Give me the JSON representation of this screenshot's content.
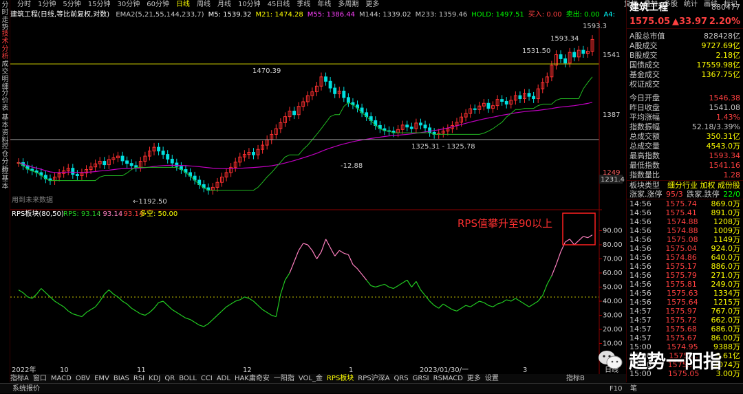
{
  "left_tabs": [
    {
      "label": "分时走势",
      "active": false
    },
    {
      "label": "技术分析",
      "active": true
    },
    {
      "label": "成交明细",
      "active": false
    },
    {
      "label": "分价表",
      "active": false
    },
    {
      "label": "基本资料",
      "active": false
    },
    {
      "label": "控仓分析",
      "active": false
    },
    {
      "label": "控基本",
      "active": false
    }
  ],
  "periods": [
    "分时",
    "1分钟",
    "5分钟",
    "15分钟",
    "30分钟",
    "60分钟",
    "日线",
    "周线",
    "月线",
    "10分钟",
    "45日线",
    "季线",
    "年线",
    "多周期",
    "更多"
  ],
  "selected_period": "日线",
  "tools": [
    "复权",
    "叠加",
    "多股",
    "统计",
    "画线",
    "标记"
  ],
  "main_title": "建筑工程(日线,等比前复权,对数)",
  "indicators": [
    {
      "t": "EMA2(5,21,55,144,233,7)",
      "c": "#c8c8c8"
    },
    {
      "t": "M5: 1539.32",
      "c": "#ffffff"
    },
    {
      "t": "M21: 1474.28",
      "c": "#ffff00"
    },
    {
      "t": "M55: 1386.44",
      "c": "#ff40ff"
    },
    {
      "t": "M144: 1339.02",
      "c": "#c8c8c8"
    },
    {
      "t": "M233: 1359.46",
      "c": "#c8c8c8"
    },
    {
      "t": "HOLD: 1497.51",
      "c": "#00ff00"
    },
    {
      "t": "买入: 0.00",
      "c": "#ff4040"
    },
    {
      "t": "卖出: 0.00",
      "c": "#00ff00"
    },
    {
      "t": "A4: 1593.34",
      "c": "#00ffff"
    },
    {
      "t": "BB: 1541.16",
      "c": "#c8c8c8"
    },
    {
      "t": "高价: 15",
      "c": "#c8c8c8"
    }
  ],
  "price_labels": {
    "p1593": "1593.34",
    "p1531": "1531.50",
    "p1470": "1470.39",
    "p1325": "1325.31 - 1325.78",
    "p1288": "-12.88",
    "p1192": "←1192.50",
    "p15933top": "1593.3"
  },
  "axis_main": {
    "a1541": "1541",
    "a1387": "1387",
    "a1231": "1231.4",
    "a1249": "1249"
  },
  "future_data_note": "用到未来数据",
  "rps": {
    "title": "RPS板块(80,50)",
    "v1": "RPS: 93.14",
    "v2": "93.14",
    "v3": "93.14",
    "v4": "多空: 50.00",
    "annot": "RPS值攀升至90以上",
    "axis": [
      "90.00",
      "80.00",
      "70.00",
      "60.00",
      "50.00",
      "40.00",
      "30.00",
      "20.00",
      "10.00"
    ]
  },
  "x_axis": [
    "2022年",
    "10",
    "11",
    "12",
    "1",
    "2023/01/30/一",
    "3",
    "日线"
  ],
  "bottom_tabs": [
    "指标A",
    "窗口",
    "MACD",
    "OBV",
    "EMV",
    "BIAS",
    "RSI",
    "KDJ",
    "QR",
    "BOLL",
    "CCI",
    "ADL",
    "HAK庸奇安",
    "一阳指",
    "VOL_金",
    "RPS板块",
    "RPS沪深A",
    "QRS",
    "GRSI",
    "RSMACD",
    "更多",
    "设置",
    "指标B"
  ],
  "selected_bottom_tab": "RPS板块",
  "status": {
    "label": "系统报价",
    "f10": "F10",
    "pen": "笔"
  },
  "watermark": "趋势一阳指",
  "panel": {
    "name": "建筑工程",
    "code": "880477",
    "price": "1575.05",
    "change": "▲33.97",
    "pct": "2.20%",
    "stats": [
      {
        "k": "A股总市值",
        "v": "828428亿",
        "c": "#c8c8c8"
      },
      {
        "k": "A股成交",
        "v": "9727.69亿",
        "c": "#ffff00"
      },
      {
        "k": "B股成交",
        "v": "2.18亿",
        "c": "#ffff00"
      },
      {
        "k": "国债成交",
        "v": "17559.98亿",
        "c": "#ffff00"
      },
      {
        "k": "基金成交",
        "v": "1367.75亿",
        "c": "#ffff00"
      },
      {
        "k": "权证成交",
        "v": "",
        "c": "#ffff00"
      },
      {
        "k": "今日开盘",
        "v": "1546.38",
        "c": "#ff4040"
      },
      {
        "k": "昨日收盘",
        "v": "1541.08",
        "c": "#c8c8c8"
      },
      {
        "k": "平均涨幅",
        "v": "1.43%",
        "c": "#ff4040"
      },
      {
        "k": "指数振幅",
        "v": "52.18/3.39%",
        "c": "#c8c8c8"
      },
      {
        "k": "总成交额",
        "v": "350.31亿",
        "c": "#ffff00"
      },
      {
        "k": "总成交量",
        "v": "4543.0万",
        "c": "#ffff00"
      },
      {
        "k": "最高指数",
        "v": "1593.34",
        "c": "#ff4040"
      },
      {
        "k": "最低指数",
        "v": "1541.16",
        "c": "#ff4040"
      },
      {
        "k": "指数量比",
        "v": "1.28",
        "c": "#ff4040"
      }
    ],
    "board_type_label": "板块类型",
    "board_type_val": "细分行业 加权 成份股",
    "up_label": "涨家.涨停",
    "up_val": "95/3",
    "down_label": "跌家.跌停",
    "down_val": "22/0",
    "ticks": [
      {
        "t": "14:56",
        "p": "1575.74",
        "v": "869.0万"
      },
      {
        "t": "14:56",
        "p": "1575.41",
        "v": "891.0万"
      },
      {
        "t": "14:56",
        "p": "1574.88",
        "v": "1208万"
      },
      {
        "t": "14:56",
        "p": "1574.88",
        "v": "1009万"
      },
      {
        "t": "14:56",
        "p": "1575.08",
        "v": "1149万"
      },
      {
        "t": "14:56",
        "p": "1575.04",
        "v": "924.0万"
      },
      {
        "t": "14:56",
        "p": "1574.86",
        "v": "640.0万"
      },
      {
        "t": "14:56",
        "p": "1575.17",
        "v": "886.0万"
      },
      {
        "t": "14:56",
        "p": "1575.79",
        "v": "271.0万"
      },
      {
        "t": "14:56",
        "p": "1575.81",
        "v": "249.0万"
      },
      {
        "t": "14:56",
        "p": "1575.63",
        "v": "1334万"
      },
      {
        "t": "14:56",
        "p": "1575.64",
        "v": "1215万"
      },
      {
        "t": "14:57",
        "p": "1575.97",
        "v": "767.0万"
      },
      {
        "t": "14:57",
        "p": "1575.72",
        "v": "662.0万"
      },
      {
        "t": "14:57",
        "p": "1575.68",
        "v": "686.0万"
      },
      {
        "t": "14:57",
        "p": "1575.67",
        "v": "86.00万"
      },
      {
        "t": "15:00",
        "p": "1574.95",
        "v": "9388万"
      },
      {
        "t": "15:00",
        "p": "1575.…",
        "v": "3.61亿"
      },
      {
        "t": "15:00",
        "p": "1575.…",
        "v": "3074万"
      },
      {
        "t": "15:00",
        "p": "1575.05",
        "v": "3.00万"
      }
    ]
  },
  "chart_data": {
    "type": "candlestick",
    "closes": [
      1255,
      1248,
      1240,
      1236,
      1232,
      1226,
      1218,
      1214,
      1222,
      1230,
      1236,
      1242,
      1228,
      1225,
      1231,
      1239,
      1245,
      1252,
      1258,
      1250,
      1262,
      1266,
      1270,
      1259,
      1253,
      1248,
      1244,
      1258,
      1270,
      1282,
      1291,
      1282,
      1274,
      1263,
      1254,
      1246,
      1239,
      1232,
      1224,
      1215,
      1205,
      1198,
      1192.5,
      1199,
      1210,
      1222,
      1232,
      1244,
      1256,
      1268,
      1274,
      1279,
      1273,
      1286,
      1296,
      1309,
      1322,
      1336,
      1351,
      1366,
      1380,
      1371,
      1392,
      1404,
      1420,
      1430,
      1445,
      1470,
      1458,
      1440,
      1425,
      1432,
      1415,
      1402,
      1396,
      1388,
      1376,
      1366,
      1356,
      1344,
      1336,
      1331,
      1330,
      1326,
      1334,
      1345,
      1340,
      1336,
      1350,
      1345,
      1338,
      1327,
      1322,
      1325,
      1330,
      1336,
      1344,
      1352,
      1365,
      1374,
      1386,
      1384,
      1393,
      1400,
      1387,
      1394,
      1410,
      1405,
      1398,
      1408,
      1420,
      1412,
      1426,
      1418,
      1412,
      1438,
      1455,
      1470,
      1502,
      1531.5,
      1520,
      1508,
      1538,
      1525,
      1544,
      1535,
      1541,
      1575
    ],
    "rps": [
      48,
      46,
      43,
      42,
      45,
      49,
      46,
      43,
      40,
      38,
      36,
      33,
      31,
      30,
      29,
      32,
      34,
      36,
      40,
      45,
      48,
      45,
      43,
      40,
      38,
      35,
      33,
      31,
      30,
      32,
      35,
      39,
      40,
      37,
      34,
      32,
      30,
      28,
      27,
      25,
      23,
      22,
      24,
      27,
      30,
      33,
      36,
      38,
      40,
      41,
      43,
      42,
      40,
      37,
      34,
      32,
      30,
      29,
      45,
      55,
      60,
      68,
      76,
      81,
      80,
      76,
      70,
      75,
      84,
      78,
      72,
      76,
      74,
      73,
      66,
      63,
      59,
      55,
      51,
      50,
      51,
      52,
      50,
      49,
      51,
      53,
      55,
      50,
      54,
      48,
      44,
      40,
      37,
      35,
      38,
      36,
      34,
      33,
      35,
      37,
      36,
      38,
      40,
      39,
      37,
      36,
      38,
      39,
      41,
      40,
      42,
      40,
      38,
      36,
      38,
      40,
      44,
      52,
      58,
      66,
      75,
      82,
      84,
      80,
      83,
      86,
      85,
      87,
      93.14
    ],
    "ylim_rps": [
      0,
      100
    ],
    "rps_threshold": 50,
    "rps_high": 80
  }
}
